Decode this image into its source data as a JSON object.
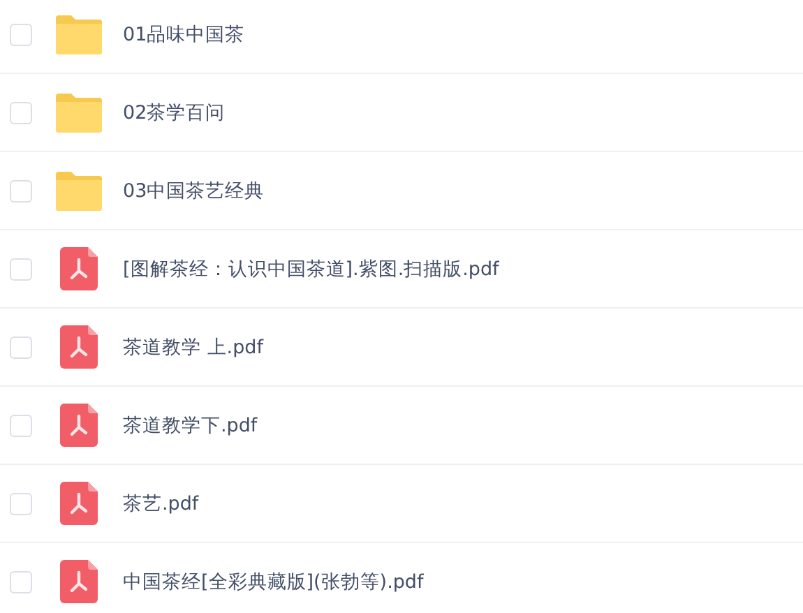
{
  "files": [
    {
      "kind": "folder",
      "name": "01品味中国茶",
      "checked": false
    },
    {
      "kind": "folder",
      "name": "02茶学百问",
      "checked": false
    },
    {
      "kind": "folder",
      "name": "03中国茶艺经典",
      "checked": false
    },
    {
      "kind": "pdf",
      "name": "[图解茶经：认识中国茶道].紫图.扫描版.pdf",
      "checked": false
    },
    {
      "kind": "pdf",
      "name": "茶道教学 上.pdf",
      "checked": false
    },
    {
      "kind": "pdf",
      "name": "茶道教学下.pdf",
      "checked": false
    },
    {
      "kind": "pdf",
      "name": "茶艺.pdf",
      "checked": false
    },
    {
      "kind": "pdf",
      "name": "中国茶经[全彩典藏版](张勃等).pdf",
      "checked": false
    }
  ]
}
